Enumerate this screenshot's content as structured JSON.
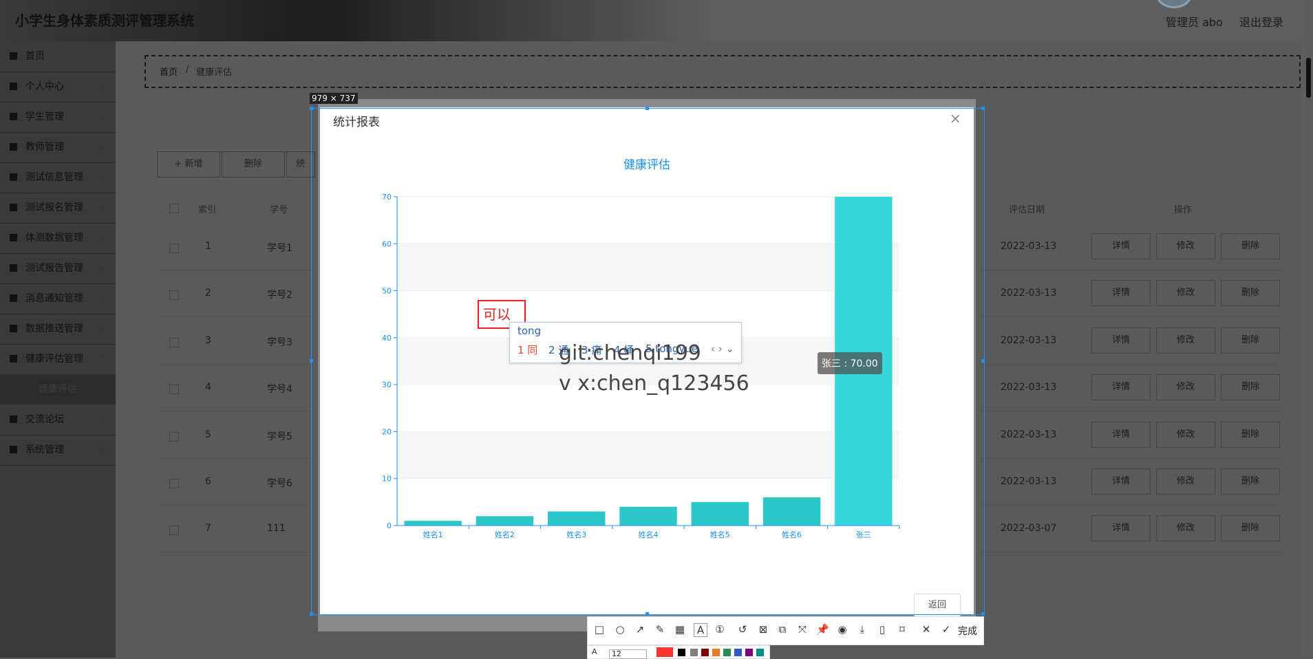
{
  "header": {
    "title": "小学生身体素质测评管理系统",
    "admin": "管理员 abo",
    "logout": "退出登录"
  },
  "sidebar": {
    "items": [
      {
        "label": "首页"
      },
      {
        "label": "个人中心"
      },
      {
        "label": "学生管理"
      },
      {
        "label": "教师管理"
      },
      {
        "label": "测试信息管理"
      },
      {
        "label": "测试报名管理"
      },
      {
        "label": "体测数据管理"
      },
      {
        "label": "测试报告管理"
      },
      {
        "label": "消息通知管理"
      },
      {
        "label": "数据推送管理"
      },
      {
        "label": "健康评估管理"
      },
      {
        "label": "健康评估"
      },
      {
        "label": "交流论坛"
      },
      {
        "label": "系统管理"
      }
    ]
  },
  "breadcrumb": {
    "home": "首页",
    "sep": "/",
    "current": "健康评估"
  },
  "toolbar": {
    "add": "+ 新增",
    "delete": "删除",
    "stats": "统"
  },
  "table": {
    "headers": [
      "索引",
      "学号",
      "评估日期",
      "操作"
    ],
    "rows": [
      {
        "idx": "1",
        "sid": "学号1",
        "date": "2022-03-13"
      },
      {
        "idx": "2",
        "sid": "学号2",
        "date": "2022-03-13"
      },
      {
        "idx": "3",
        "sid": "学号3",
        "date": "2022-03-13"
      },
      {
        "idx": "4",
        "sid": "学号4",
        "date": "2022-03-13"
      },
      {
        "idx": "5",
        "sid": "学号5",
        "date": "2022-03-13"
      },
      {
        "idx": "6",
        "sid": "学号6",
        "date": "2022-03-13"
      },
      {
        "idx": "7",
        "sid": "111",
        "date": "2022-03-07"
      }
    ],
    "actions": {
      "detail": "详情",
      "edit": "修改",
      "remove": "删除"
    }
  },
  "modal": {
    "title": "统计报表",
    "close": "×",
    "back": "返回"
  },
  "capture": {
    "size": "979 × 737",
    "done": "完成",
    "font_size": "12"
  },
  "annotation": {
    "text": "可以",
    "ime_input": "tong",
    "candidates": [
      "1 同",
      "2 通",
      "3 痛",
      "4 桶",
      "5 tongyue"
    ]
  },
  "watermark": {
    "line1": "git:chenqi199",
    "line2": "v x:chen_q123456"
  },
  "tooltip": {
    "text": "张三 : 70.00"
  },
  "colors": {
    "bar": "#2ec7c9",
    "bar_highlight": "#35d9dc",
    "axis": "#1890ff",
    "title": "#1890ff",
    "annotation": "#e32222",
    "swatches": [
      "#ff3333",
      "#000000",
      "#808080",
      "#800000",
      "#e67e22",
      "#2e8b57",
      "#3355cc",
      "#800080",
      "#008b8b"
    ]
  },
  "chart_data": {
    "type": "bar",
    "title": "健康评估",
    "categories": [
      "姓名1",
      "姓名2",
      "姓名3",
      "姓名4",
      "姓名5",
      "姓名6",
      "张三"
    ],
    "values": [
      1,
      2,
      3,
      4,
      5,
      6,
      70
    ],
    "ylim": [
      0,
      70
    ],
    "yticks": [
      0,
      10,
      20,
      30,
      40,
      50,
      60,
      70
    ],
    "grid": "horizontal bands",
    "xlabel": "",
    "ylabel": ""
  }
}
